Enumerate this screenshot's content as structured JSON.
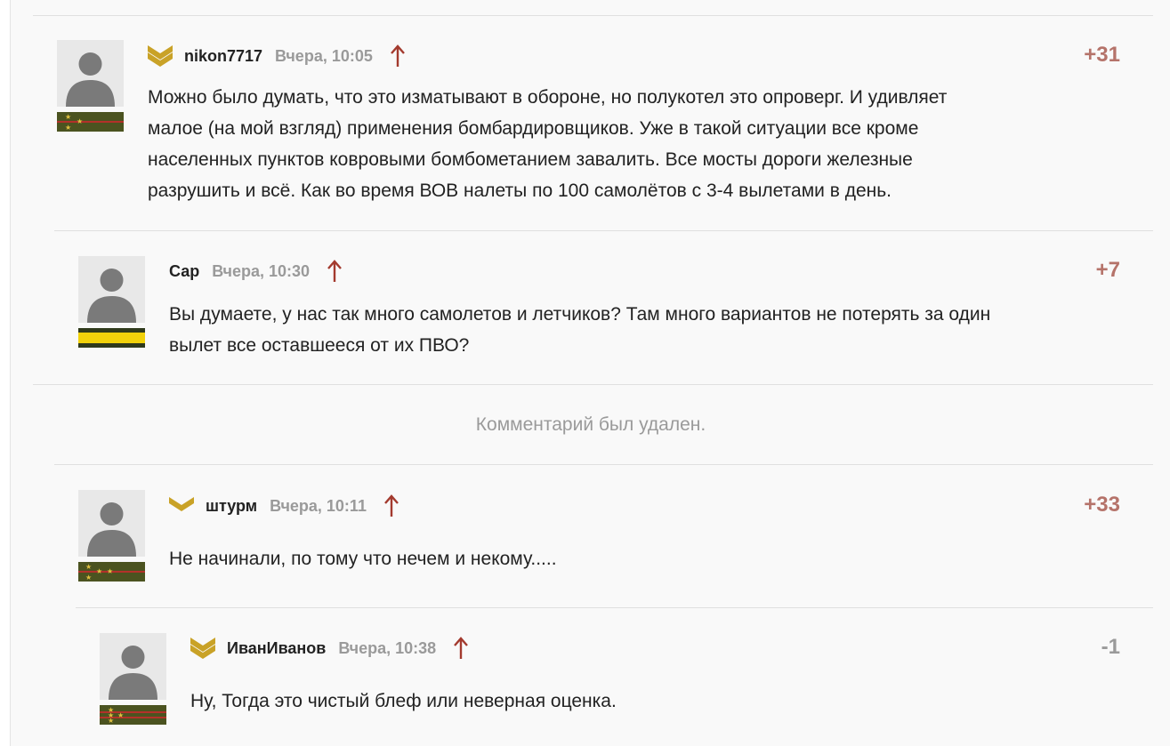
{
  "comments": [
    {
      "author": "nikon7717",
      "timestamp": "Вчера, 10:05",
      "score": "+31",
      "text_lines": [
        "Можно было думать, что это изматывают в обороне, но полукотел это опроверг. И удивляет",
        "малое (на мой взгляд) применения бомбардировщиков. Уже в такой ситуации все кроме",
        "населенных пунктов ковровыми бомбометанием завалить. Все мосты дороги железные",
        "разрушить и всё. Как во время ВОВ налеты по 100 самолётов с 3-4 вылетами в день."
      ],
      "has_badge": true,
      "rank_icon": "rank-stripe-two-stars-icon"
    },
    {
      "author": "Сар",
      "timestamp": "Вчера, 10:30",
      "score": "+7",
      "text_lines": [
        "Вы думаете, у нас так много самолетов и летчиков? Там много вариантов не потерять за один",
        "вылет все оставшееся от их ПВО?"
      ],
      "has_badge": false,
      "rank_icon": "rank-stripe-yellow-icon"
    },
    {
      "author": "штурм",
      "timestamp": "Вчера, 10:11",
      "score": "+33",
      "text_lines": [
        "Не начинали, по тому что нечем и некому....."
      ],
      "has_badge": true,
      "rank_icon": "rank-stripe-three-stars-icon"
    },
    {
      "author": "ИванИванов",
      "timestamp": "Вчера, 10:38",
      "score": "-1",
      "text_lines": [
        "Ну, Тогда это чистый блеф или неверная оценка."
      ],
      "has_badge": true,
      "rank_icon": "rank-stripe-four-stars-icon"
    }
  ],
  "deleted_notice": "Комментарий был удален.",
  "colors": {
    "score_positive": "#b5736a",
    "score_negative": "#9a9a9a",
    "reply_arrow": "#a33a2e",
    "badge_gold": "#c9a227",
    "rank_olive": "#4b5320",
    "rank_yellow": "#f2d20a"
  }
}
